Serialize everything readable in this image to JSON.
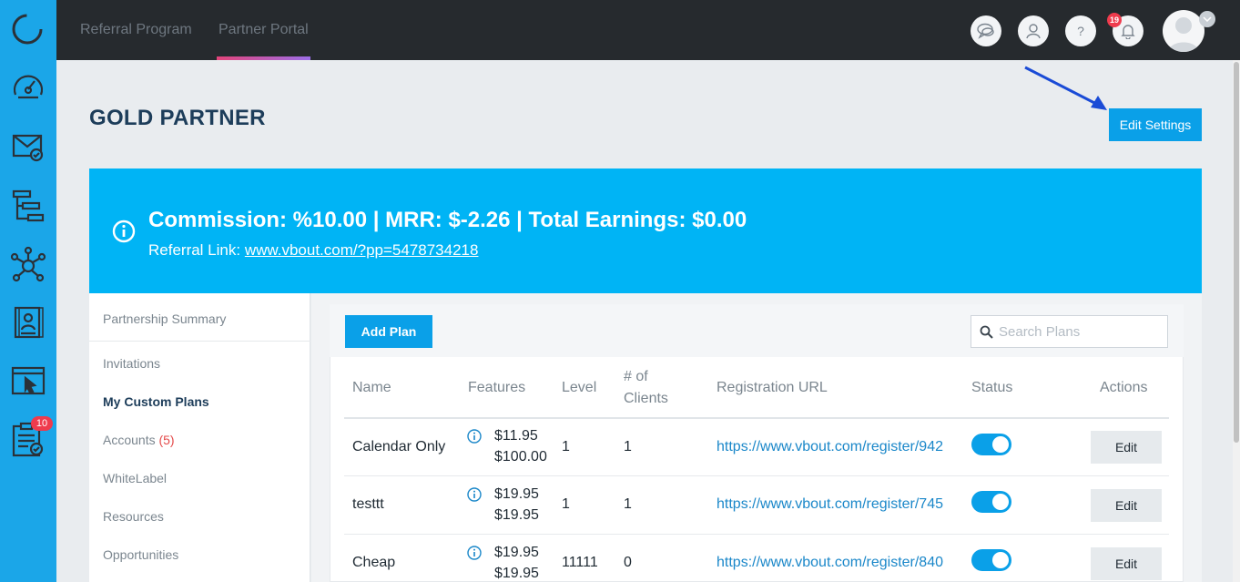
{
  "sidebar": {
    "badge": "10",
    "icons": [
      "dashboard-icon",
      "mail-icon",
      "workflow-icon",
      "network-icon",
      "contacts-icon",
      "landing-page-icon",
      "tasks-icon"
    ]
  },
  "topbar": {
    "tabs": [
      {
        "label": "Referral Program"
      },
      {
        "label": "Partner Portal"
      }
    ],
    "help_label": "?",
    "notifications_count": "19"
  },
  "header": {
    "title": "GOLD PARTNER",
    "edit_settings_label": "Edit Settings"
  },
  "banner": {
    "summary": "Commission: %10.00 | MRR: $-2.26 | Total Earnings: $0.00",
    "referral_label": "Referral Link:",
    "referral_link": "www.vbout.com/?pp=5478734218"
  },
  "submenu": {
    "items": [
      {
        "label": "Partnership Summary"
      },
      {
        "label": "Invitations"
      },
      {
        "label": "My Custom Plans"
      },
      {
        "label": "Accounts",
        "count": "(5)"
      },
      {
        "label": "WhiteLabel"
      },
      {
        "label": "Resources"
      },
      {
        "label": "Opportunities"
      }
    ]
  },
  "plans": {
    "add_label": "Add Plan",
    "search_placeholder": "Search Plans",
    "columns": [
      "Name",
      "Features",
      "Level",
      "# of",
      "Clients",
      "Registration URL",
      "Status",
      "Actions"
    ],
    "rows": [
      {
        "name": "Calendar Only",
        "price1": "$11.95",
        "price2": "$100.00",
        "level": "1",
        "clients": "1",
        "url": "https://www.vbout.com/register/942",
        "status_on": true,
        "action": "Edit"
      },
      {
        "name": "testtt",
        "price1": "$19.95",
        "price2": "$19.95",
        "level": "1",
        "clients": "1",
        "url": "https://www.vbout.com/register/745",
        "status_on": true,
        "action": "Edit"
      },
      {
        "name": "Cheap",
        "price1": "$19.95",
        "price2": "$19.95",
        "level": "11111",
        "clients": "0",
        "url": "https://www.vbout.com/register/840",
        "status_on": true,
        "action": "Edit"
      }
    ]
  },
  "colors": {
    "rail": "#1ba6e8",
    "banner": "#00b4f5",
    "primary_button": "#0aa0e8",
    "topbar": "#262a2e",
    "title": "#1d3d5a",
    "link": "#1a87c9",
    "annotation_arrow": "#1a4bd6"
  }
}
